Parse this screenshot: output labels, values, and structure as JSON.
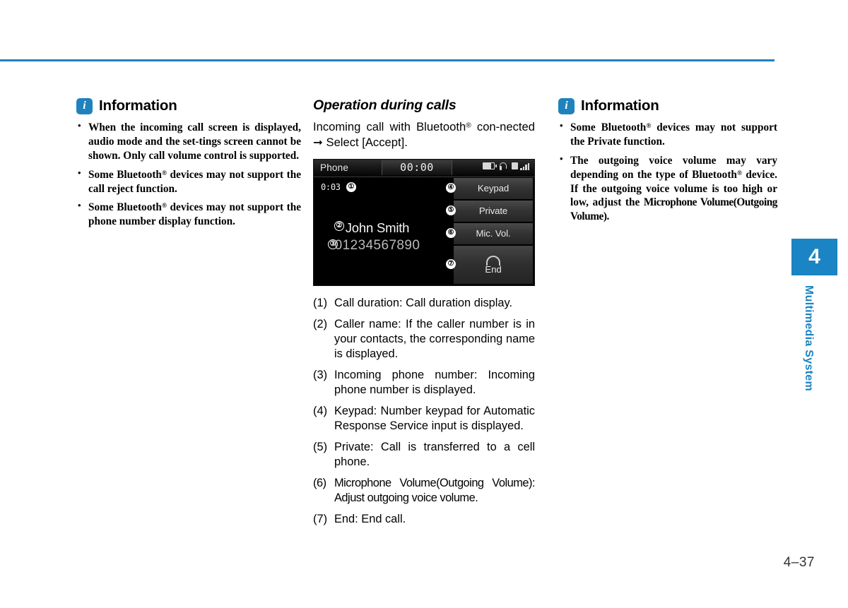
{
  "page": {
    "folio": "4–37",
    "chapter_number": "4",
    "chapter_label": "Multimedia System",
    "accent_color": "#1b84c4",
    "rule_color": "#1f82bd"
  },
  "left_column": {
    "info": {
      "icon": "info-icon",
      "title": "Information",
      "bullets": [
        "When the incoming call screen is displayed, audio mode and the set-tings screen cannot be shown. Only call volume control is supported.",
        "Some Bluetooth® devices may not support the call reject function.",
        "Some Bluetooth® devices may not support the phone number display function."
      ]
    }
  },
  "middle_column": {
    "section_heading": "Operation during calls",
    "intro": "Incoming call with Bluetooth® con-nected → Select [Accept].",
    "screenshot": {
      "title": "Phone",
      "clock": "00:00",
      "status_icons": [
        "battery-icon",
        "headset-icon",
        "signal-icon"
      ],
      "call_duration": "0:03",
      "caller_name": "John Smith",
      "caller_number": "01234567890",
      "buttons": [
        {
          "label": "Keypad",
          "callout": "④"
        },
        {
          "label": "Private",
          "callout": "⑤"
        },
        {
          "label": "Mic. Vol.",
          "callout": "⑥"
        },
        {
          "label": "End",
          "callout": "⑦",
          "icon": "hangup-icon"
        }
      ],
      "callouts": {
        "duration": "①",
        "name": "②",
        "number": "③"
      }
    },
    "legend": [
      {
        "num": "(1)",
        "text": "Call duration: Call duration display."
      },
      {
        "num": "(2)",
        "text": "Caller name: If the caller number is in your contacts, the corresponding name is displayed."
      },
      {
        "num": "(3)",
        "text": "Incoming phone number: Incoming phone number is displayed."
      },
      {
        "num": "(4)",
        "text": "Keypad: Number keypad for Automatic Response Service input is displayed."
      },
      {
        "num": "(5)",
        "text": "Private: Call is transferred to a cell phone."
      },
      {
        "num": "(6)",
        "text": "Microphone Volume(Outgoing Volume): Adjust outgoing voice volume."
      },
      {
        "num": "(7)",
        "text": "End: End call."
      }
    ]
  },
  "right_column": {
    "info": {
      "icon": "info-icon",
      "title": "Information",
      "bullets": [
        "Some Bluetooth® devices may not support the Private function.",
        "The outgoing voice volume may vary depending on the type of Bluetooth® device. If the outgoing voice volume is too high or low, adjust the Microphone Volume(Outgoing Volume)."
      ]
    }
  }
}
